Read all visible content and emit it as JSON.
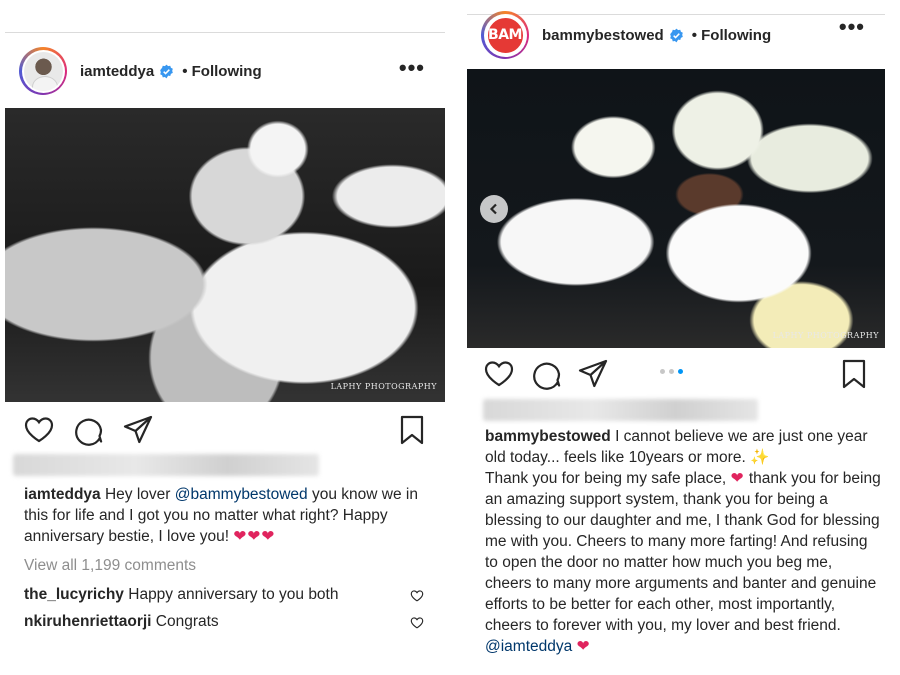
{
  "left_post": {
    "username": "iamteddya",
    "follow_label": "Following",
    "more_label": "•••",
    "photo_watermark": "LAPHY PHOTOGRAPHY",
    "caption": {
      "user": "iamteddya",
      "text_before_mention": " Hey lover ",
      "mention": "@bammybestowed",
      "text_after_mention": " you know we in this for life and I got you no matter what right? Happy anniversary bestie, I love you! ",
      "hearts": "❤❤❤"
    },
    "view_all_comments": "View all 1,199 comments",
    "comments": [
      {
        "user": "the_lucyrichy",
        "text": "Happy anniversary to you both"
      },
      {
        "user": "nkiruhenriettaorji",
        "text": "Congrats"
      }
    ]
  },
  "right_post": {
    "username": "bammybestowed",
    "avatar_text": "BAM",
    "follow_label": "Following",
    "more_label": "•••",
    "photo_watermark": "LAPHY PHOTOGRAPHY",
    "carousel": {
      "count": 3,
      "active_index": 2
    },
    "caption": {
      "user": "bammybestowed",
      "text_1": " I cannot believe we are just one year old today... feels like 10years or more. ",
      "sparkle": "✨",
      "text_2": "Thank you for being my safe place, ",
      "heart_1": "❤",
      "text_3": " thank you for being an amazing support system, thank you for being a blessing to our daughter and me, I thank God for blessing me with you. Cheers to many more farting! And refusing to open the door no matter how much you beg me, cheers to many more arguments and banter and genuine efforts to be better for each other, most importantly, cheers to forever with you, my lover and best friend. ",
      "mention": "@iamteddya",
      "heart_2": "❤"
    }
  },
  "colors": {
    "text": "#262626",
    "muted": "#8e8e8e",
    "mention": "#00376b",
    "verified": "#3897f0",
    "heart": "#e0245e",
    "active_dot": "#0095f6"
  }
}
